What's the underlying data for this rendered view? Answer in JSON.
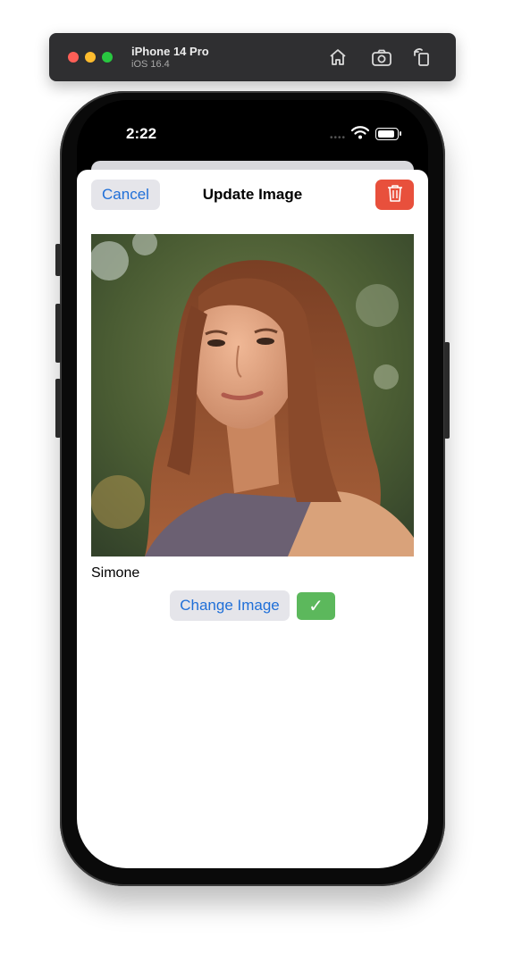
{
  "simulator": {
    "device_name": "iPhone 14 Pro",
    "os_version": "iOS 16.4",
    "icons": [
      "home-icon",
      "screenshot-icon",
      "rotate-icon"
    ]
  },
  "status_bar": {
    "time": "2:22",
    "icons": [
      "wifi-icon",
      "battery-icon"
    ]
  },
  "sheet": {
    "cancel_label": "Cancel",
    "title": "Update Image",
    "delete_icon": "trash-icon",
    "image_alt": "Portrait photo",
    "name": "Simone",
    "change_image_label": "Change Image",
    "confirm_symbol": "✓"
  },
  "colors": {
    "accent_blue": "#1f6fd8",
    "delete_red": "#e8503c",
    "confirm_green": "#5cb85c",
    "button_gray": "#e5e5ea"
  }
}
